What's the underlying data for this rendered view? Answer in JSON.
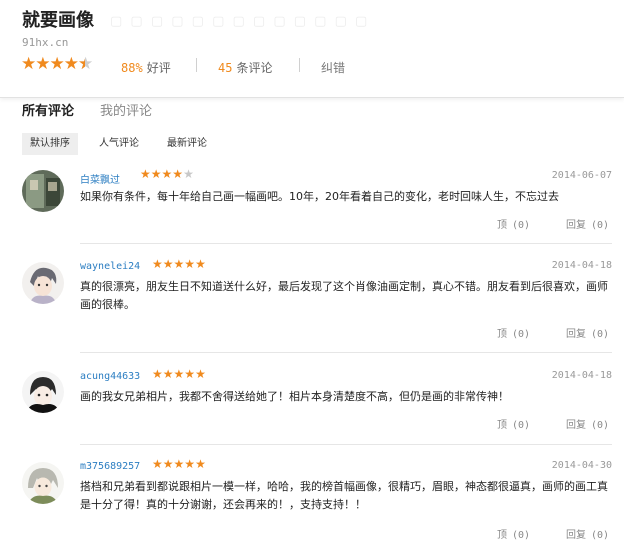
{
  "header": {
    "title": "就要画像",
    "domain": "91hx.cn",
    "rating_stars": 4.5,
    "positive_rate": "88%",
    "positive_label": "好评",
    "review_count": "45",
    "review_label": "条评论",
    "report_label": "纠错"
  },
  "tabs": [
    {
      "label": "所有评论",
      "active": true
    },
    {
      "label": "我的评论",
      "active": false
    }
  ],
  "sort": [
    {
      "label": "默认排序",
      "active": true
    },
    {
      "label": "人气评论",
      "active": false
    },
    {
      "label": "最新评论",
      "active": false
    }
  ],
  "colors": {
    "star": "#f08a1e",
    "username": "#2c7ec2",
    "accent_number": "#f08a1e"
  },
  "reviews": [
    {
      "user": "白菜飘过",
      "stars": 4,
      "date": "2014-06-07",
      "text": "如果你有条件，每十年给自己画一幅画吧。10年，20年看着自己的变化，老时回味人生，不忘过去",
      "support_label": "顶",
      "support_count": "(0)",
      "reply_label": "回复",
      "reply_count": "(0)"
    },
    {
      "user": "waynelei24",
      "stars": 5,
      "date": "2014-04-18",
      "text": "真的很漂亮，朋友生日不知道送什么好，最后发现了这个肖像油画定制，真心不错。朋友看到后很喜欢，画师画的很棒。",
      "support_label": "顶",
      "support_count": "(0)",
      "reply_label": "回复",
      "reply_count": "(0)"
    },
    {
      "user": "acung44633",
      "stars": 5,
      "date": "2014-04-18",
      "text": "画的我女兄弟相片，我都不舍得送给她了！相片本身清楚度不高，但仍是画的非常传神！",
      "support_label": "顶",
      "support_count": "(0)",
      "reply_label": "回复",
      "reply_count": "(0)"
    },
    {
      "user": "m375689257",
      "stars": 5,
      "date": "2014-04-30",
      "text": "搭档和兄弟看到都说跟相片一模一样，哈哈，我的榜首幅画像，很精巧，眉眼，神态都很逼真，画师的画工真是十分了得！真的十分谢谢，还会再来的！，支持支持！！",
      "support_label": "顶",
      "support_count": "(0)",
      "reply_label": "回复",
      "reply_count": "(0)"
    }
  ]
}
